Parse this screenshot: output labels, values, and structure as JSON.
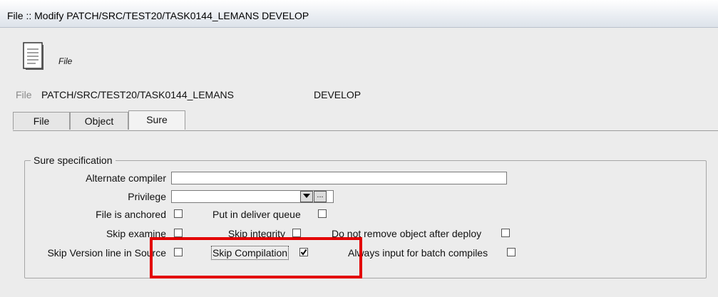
{
  "window": {
    "title": "File :: Modify PATCH/SRC/TEST20/TASK0144_LEMANS DEVELOP"
  },
  "header": {
    "icon": "document-icon",
    "type_label": "File"
  },
  "info": {
    "label": "File",
    "path": "PATCH/SRC/TEST20/TASK0144_LEMANS",
    "branch": "DEVELOP"
  },
  "tabs": [
    {
      "label": "File",
      "active": false
    },
    {
      "label": "Object",
      "active": false
    },
    {
      "label": "Sure",
      "active": true
    }
  ],
  "sure_spec": {
    "legend": "Sure specification",
    "alternate_compiler": {
      "label": "Alternate compiler",
      "value": ""
    },
    "privilege": {
      "label": "Privilege",
      "value": "",
      "browse_label": "..."
    },
    "options": [
      {
        "label": "File is anchored",
        "checked": false
      },
      {
        "label": "Put in deliver queue",
        "checked": false
      },
      {
        "label": "Skip examine",
        "checked": false
      },
      {
        "label": "Skip integrity",
        "checked": false
      },
      {
        "label": "Do not remove object after deploy",
        "checked": false
      },
      {
        "label": "Skip Version line in Source",
        "checked": false
      },
      {
        "label": "Skip Compilation",
        "checked": true
      },
      {
        "label": "Always input for batch compiles",
        "checked": false
      }
    ]
  },
  "annotation": {
    "color": "#e30000"
  }
}
